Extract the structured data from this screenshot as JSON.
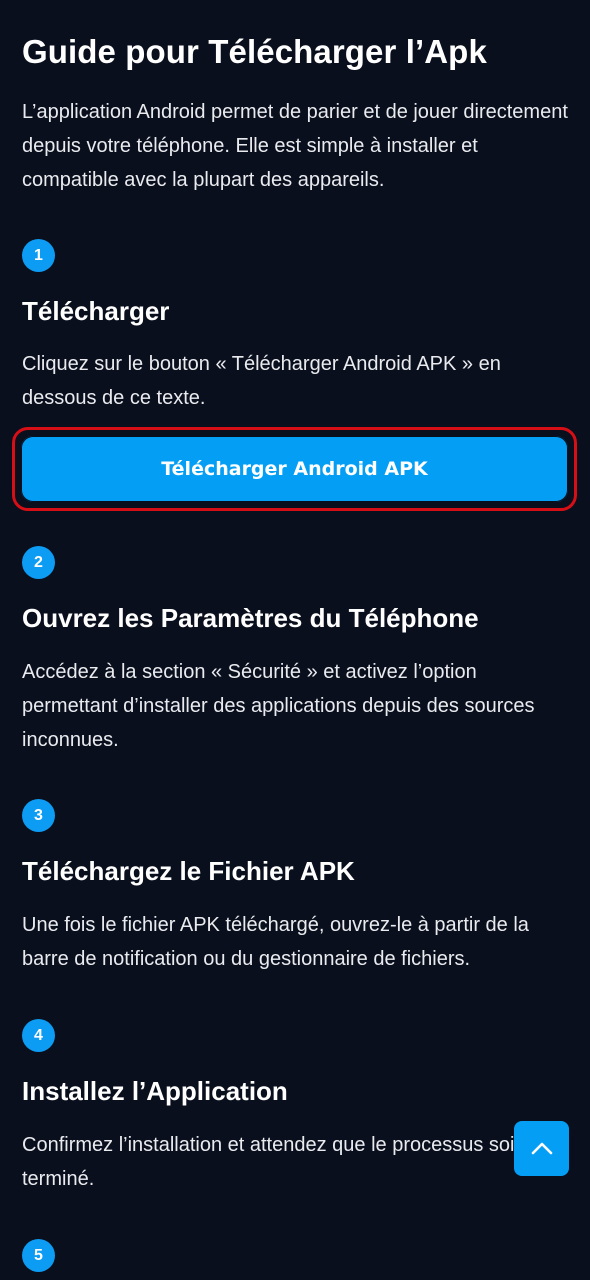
{
  "header": {
    "title": "Guide pour Télécharger l’Apk",
    "intro": "L’application Android permet de parier et de jouer directement depuis votre téléphone. Elle est simple à installer et compatible avec la plupart des appareils."
  },
  "steps": [
    {
      "number": "1",
      "title": "Télécharger",
      "text": "Cliquez sur le bouton « Télécharger Android APK » en dessous de ce texte."
    },
    {
      "number": "2",
      "title": "Ouvrez les Paramètres du Téléphone",
      "text": "Accédez à la section « Sécurité » et activez l’option permettant d’installer des applications depuis des sources inconnues."
    },
    {
      "number": "3",
      "title": "Téléchargez le Fichier APK",
      "text": "Une fois le fichier APK téléchargé, ouvrez-le à partir de la barre de notification ou du gestionnaire de fichiers."
    },
    {
      "number": "4",
      "title": "Installez l’Application",
      "text": "Confirmez l’installation et attendez que le processus soit terminé."
    },
    {
      "number": "5"
    }
  ],
  "download_button": {
    "label": "Télécharger Android APK"
  },
  "scroll_top": {
    "icon": "chevron-up-icon"
  },
  "colors": {
    "background": "#0a0f1d",
    "accent": "#049ff5",
    "highlight_outline": "#d60f16"
  }
}
